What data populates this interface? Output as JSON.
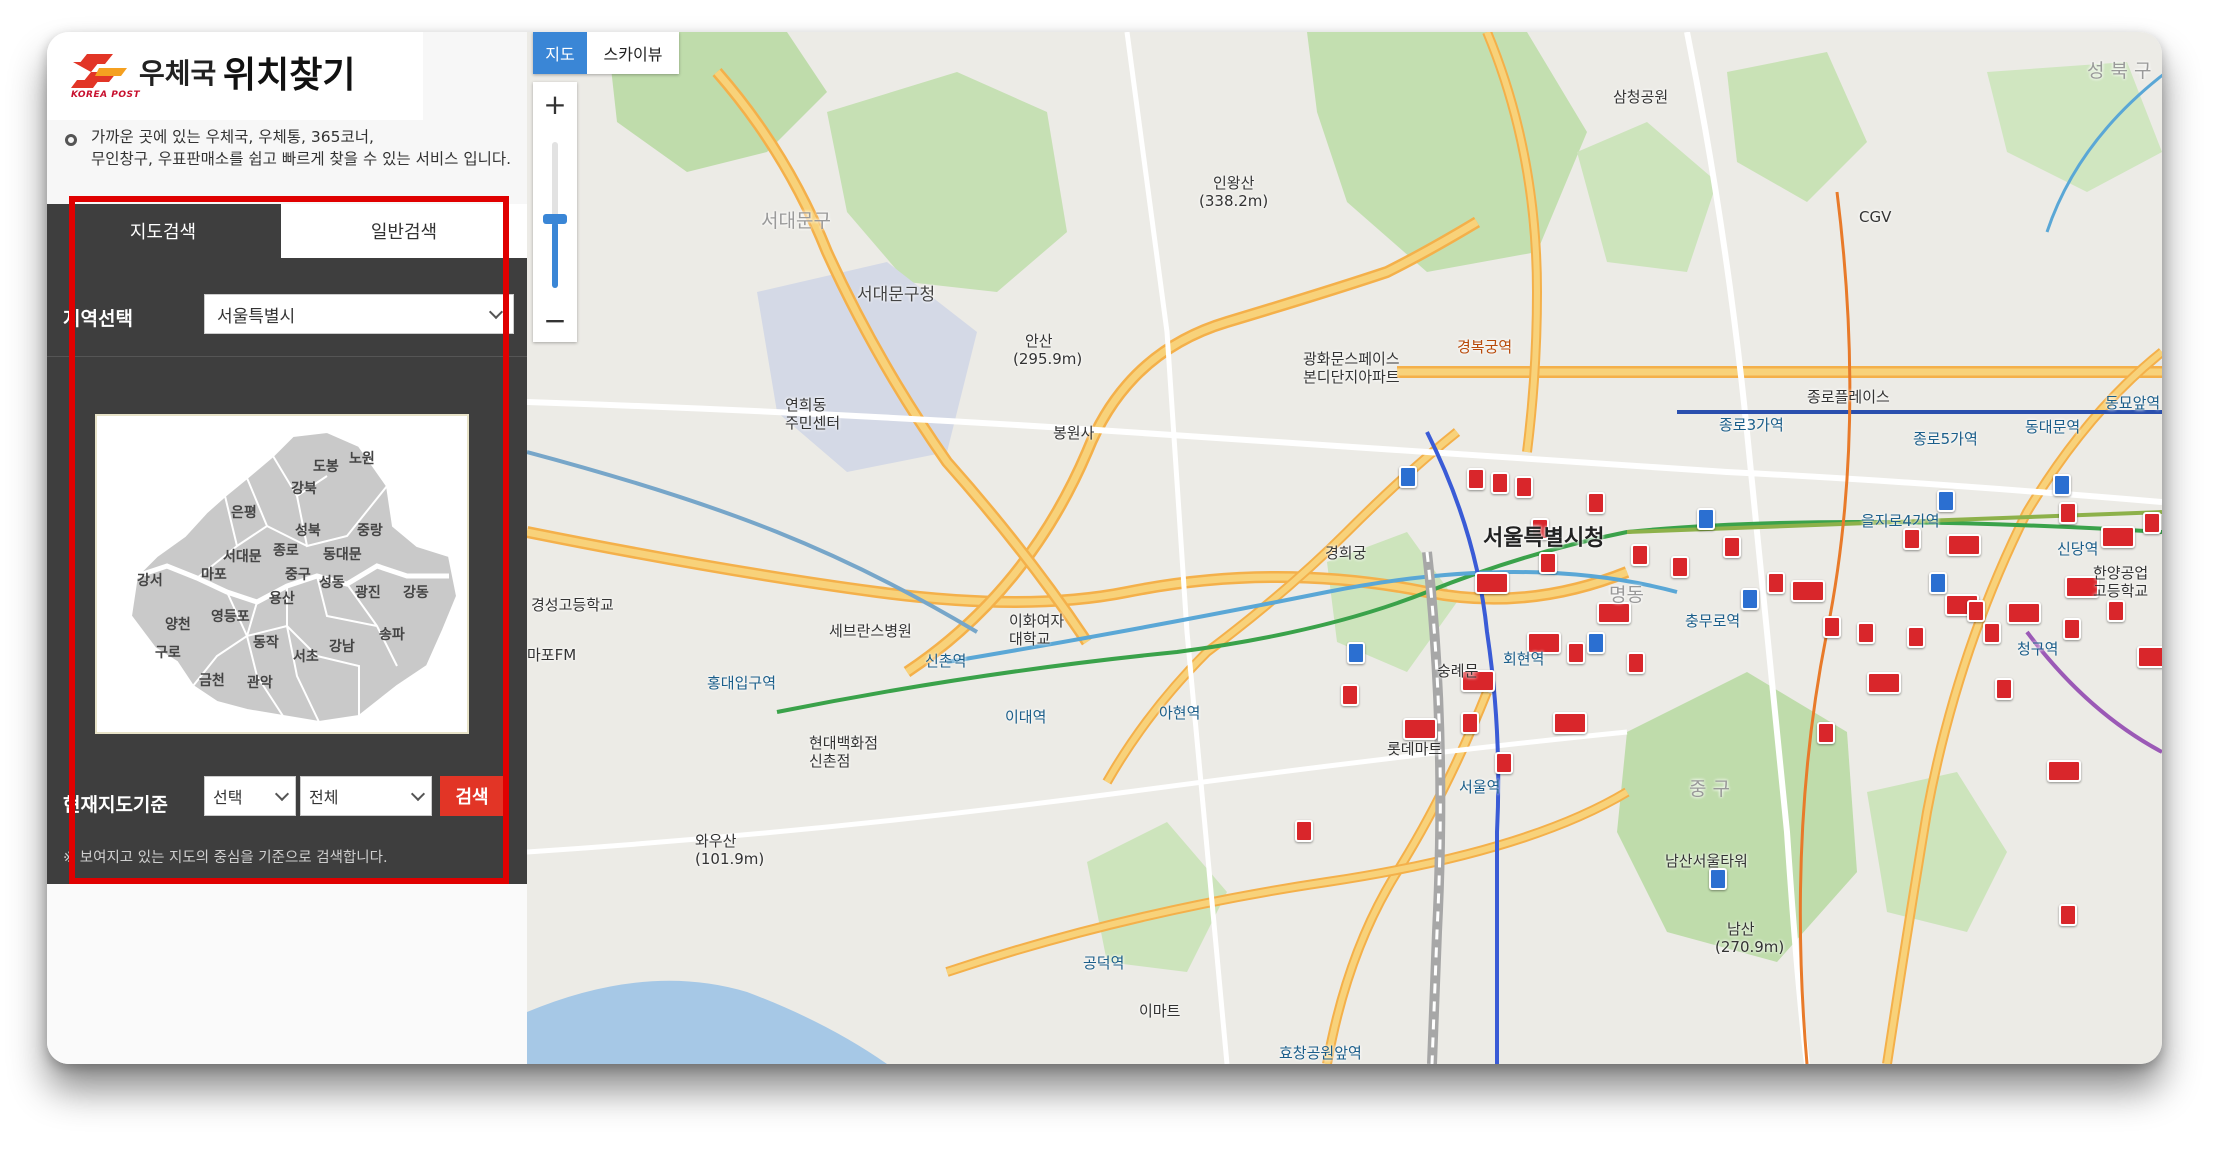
{
  "header": {
    "logo_sub": "KOREA POST",
    "org": "우체국",
    "title": "위치찾기",
    "intro_line1": "가까운 곳에 있는 우체국, 우체통, 365코너,",
    "intro_line2": "무인창구, 우표판매소를 쉽고 빠르게 찾을 수 있는 서비스 입니다."
  },
  "tabs": {
    "map_search": "지도검색",
    "general_search": "일반검색"
  },
  "region": {
    "label": "지역선택",
    "selected": "서울특별시"
  },
  "districts": [
    "도봉",
    "노원",
    "강북",
    "은평",
    "성북",
    "중랑",
    "종로",
    "서대문",
    "동대문",
    "마포",
    "중구",
    "강서",
    "성동",
    "광진",
    "강동",
    "용산",
    "양천",
    "영등포",
    "동작",
    "구로",
    "강남",
    "송파",
    "서초",
    "금천",
    "관악"
  ],
  "current": {
    "label": "현재지도기준",
    "select_a": "선택",
    "select_b": "전체",
    "search_button": "검색",
    "note": "※ 보여지고 있는 지도의 중심을 기준으로 검색합니다."
  },
  "map": {
    "type_map": "지도",
    "type_sky": "스카이뷰",
    "zoom_in": "+",
    "zoom_out": "−",
    "labels": {
      "seoul_cityhall": "서울특별시청",
      "seodaemun_gu": "서대문구",
      "seodaemun_office": "서대문구청",
      "jung_gu": "중 구",
      "gyeongbokgung": "경복궁역",
      "anyang": "안산",
      "anyang_h": "(295.9m)",
      "inwangsan": "인왕산",
      "inwangsan_h": "(338.2m)",
      "namsan": "남산",
      "namsan_h": "(270.9m)",
      "seongbuk": "성 북 구",
      "jongno3": "종로3가역",
      "jongno5": "종로5가역",
      "dongdaemun": "동대문역",
      "euljiro4": "을지로4가역",
      "chungmuro": "충무로역",
      "hongik": "홍대입구역",
      "sinchon": "신촌역",
      "idae": "이대역",
      "ahyeon": "아현역",
      "gongdeok": "공덕역",
      "seoulstation": "서울역",
      "bongwonsa": "봉원사",
      "severance": "세브란스병원",
      "ewha": "이화여자\n대학교",
      "yonsei": "연희동\n주민센터",
      "hyundai": "현대백화점\n신촌점",
      "sinsa": "신당역",
      "cheonggu": "청구역",
      "dongmyo": "동묘앞역",
      "hyojang": "효창공원앞역",
      "emart": "이마트",
      "lottemart": "롯데마트",
      "sungnyemun": "숭례문",
      "hoehyeon": "회현역",
      "myeongdong": "명동",
      "gwanghwamun": "광화문스페이스\n본디단지아파트",
      "geunjeong": "경희궁",
      "mapo_fm": "마포FM",
      "wawasan": "와우산\n(101.9m)",
      "gyeongsang": "경성고등학교",
      "namsan_tower": "남산서울타워",
      "cgv": "CGV",
      "samcheong": "삼청공원",
      "jongno_tower": "종로플레이스",
      "dongdaemun_hs": "한양공업\n고등학교"
    }
  }
}
